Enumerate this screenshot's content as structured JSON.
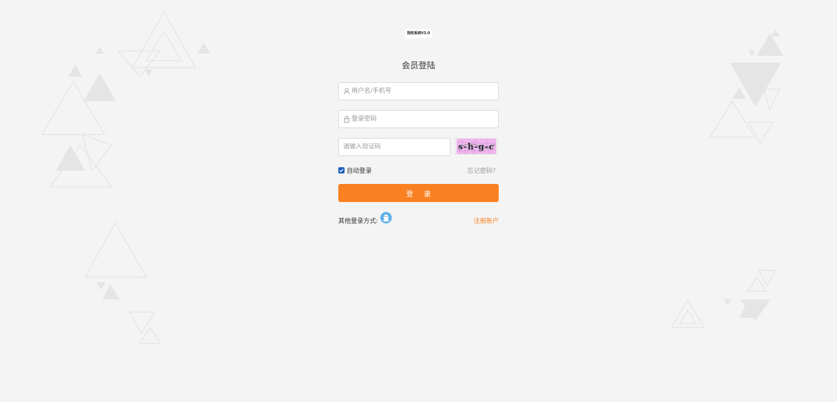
{
  "logo": {
    "text": "授权系统V3.0"
  },
  "form": {
    "title": "会员登陆",
    "username_placeholder": "用户名/手机号",
    "password_placeholder": "登录密码",
    "captcha_placeholder": "请输入验证码",
    "captcha_text": "s-h-g-c",
    "remember_label": "自动登录",
    "remember_checked": true,
    "forgot_label": "忘记密码？",
    "login_button": "登 录",
    "other_login_label": "其他登录方式:",
    "register_label": "注册账户"
  },
  "colors": {
    "accent": "#f98121",
    "checkbox": "#1e5fbf",
    "qq_icon": "#5bb0e8",
    "background": "#f4f4f4"
  },
  "icons": {
    "username": "user-icon",
    "password": "lock-icon",
    "social": "qq-icon"
  }
}
